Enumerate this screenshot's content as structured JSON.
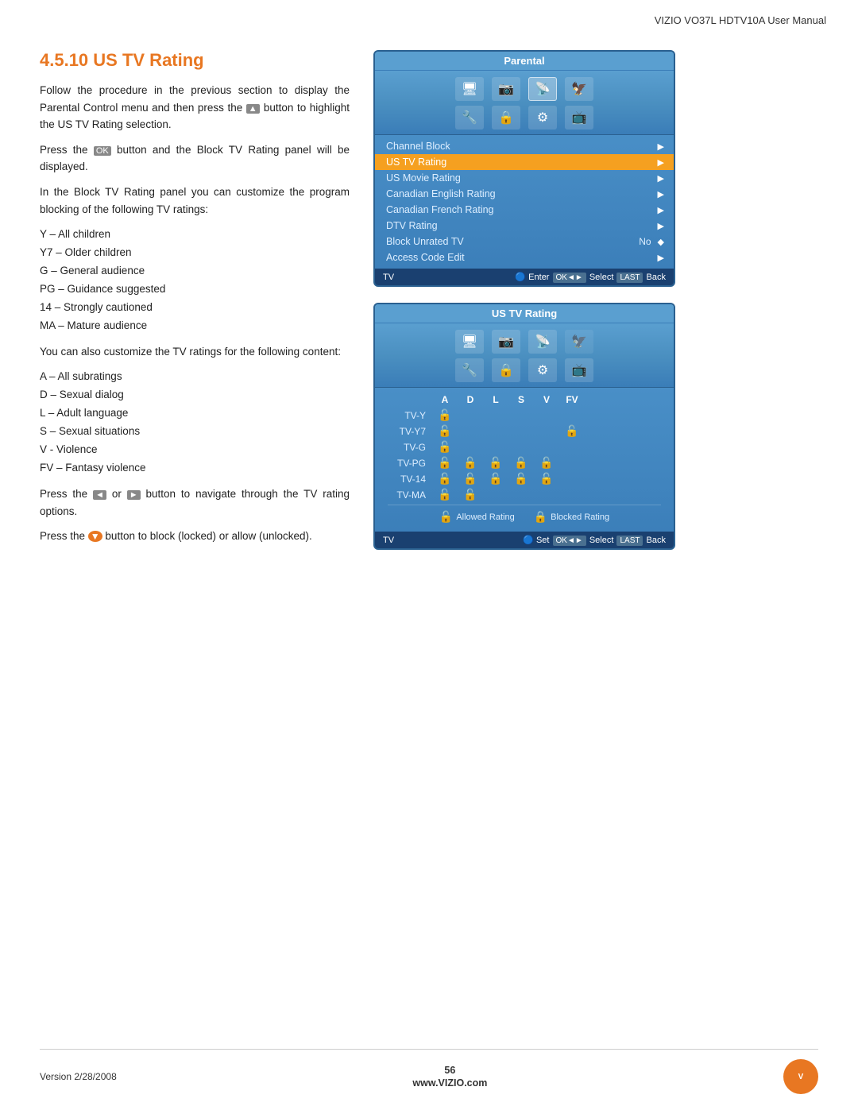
{
  "header": {
    "title": "VIZIO VO37L HDTV10A User Manual"
  },
  "section": {
    "number": "4.5.10",
    "title": "US TV Rating",
    "paragraphs": [
      "Follow the procedure in the previous section to display the Parental Control menu and then press the  button to highlight the US TV Rating selection.",
      "Press the  button and the Block TV Rating panel will be displayed.",
      "In the Block TV Rating panel you can customize the program blocking of the following TV ratings:"
    ],
    "ratings_list": [
      "Y – All children",
      "Y7 – Older children",
      "G – General audience",
      "PG – Guidance suggested",
      "14 – Strongly cautioned",
      "MA – Mature audience"
    ],
    "subratings_intro": "You can also customize the TV ratings for the following content:",
    "subratings_list": [
      "A – All subratings",
      "D – Sexual dialog",
      "L – Adult language",
      "S – Sexual situations",
      "V - Violence",
      "FV – Fantasy violence"
    ],
    "navigate_text": "Press the  or  button to navigate through the TV rating options.",
    "block_text": "Press the  button to block (locked) or allow (unlocked)."
  },
  "parental_panel": {
    "title": "Parental",
    "menu_items": [
      {
        "label": "Channel Block",
        "value": "",
        "type": "arrow",
        "highlighted": false
      },
      {
        "label": "US TV Rating",
        "value": "",
        "type": "arrow",
        "highlighted": true
      },
      {
        "label": "US Movie Rating",
        "value": "",
        "type": "arrow",
        "highlighted": false
      },
      {
        "label": "Canadian English Rating",
        "value": "",
        "type": "arrow",
        "highlighted": false
      },
      {
        "label": "Canadian French Rating",
        "value": "",
        "type": "arrow",
        "highlighted": false
      },
      {
        "label": "DTV Rating",
        "value": "",
        "type": "arrow",
        "highlighted": false
      },
      {
        "label": "Block Unrated TV",
        "value": "No",
        "type": "diamond",
        "highlighted": false
      },
      {
        "label": "Access Code Edit",
        "value": "",
        "type": "arrow",
        "highlighted": false
      }
    ],
    "footer_left": "TV",
    "footer_right": "Enter  Select  Back"
  },
  "rating_panel": {
    "title": "US TV Rating",
    "categories": [
      "A",
      "D",
      "L",
      "S",
      "V",
      "FV"
    ],
    "rows": [
      {
        "label": "TV-Y",
        "cells": [
          true,
          false,
          false,
          false,
          false,
          false
        ]
      },
      {
        "label": "TV-Y7",
        "cells": [
          false,
          false,
          false,
          false,
          false,
          true
        ]
      },
      {
        "label": "TV-G",
        "cells": [
          false,
          false,
          false,
          false,
          false,
          false
        ]
      },
      {
        "label": "TV-PG",
        "cells": [
          false,
          true,
          true,
          true,
          true,
          false
        ]
      },
      {
        "label": "TV-14",
        "cells": [
          false,
          true,
          true,
          true,
          true,
          false
        ]
      },
      {
        "label": "TV-MA",
        "cells": [
          false,
          true,
          false,
          false,
          false,
          false
        ]
      }
    ],
    "legend_allowed": "Allowed Rating",
    "legend_blocked": "Blocked Rating",
    "footer_left": "TV",
    "footer_right": "Set  Select  Back"
  },
  "footer": {
    "version": "Version 2/28/2008",
    "page": "56",
    "url": "www.VIZIO.com",
    "logo_text": "V"
  }
}
